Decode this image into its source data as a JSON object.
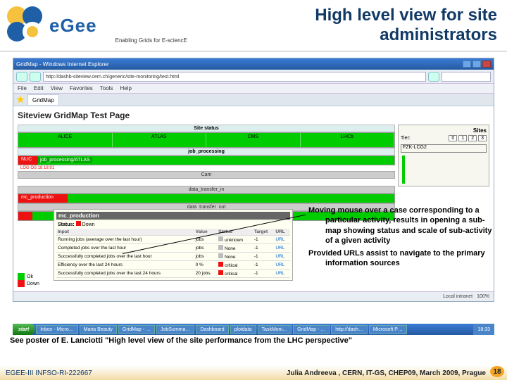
{
  "header": {
    "logo_text": "eGee",
    "tagline": "Enabling Grids for E-sciencE",
    "title_line1": "High level view for site",
    "title_line2": "administrators"
  },
  "browser": {
    "window_title": "GridMap - Windows Internet Explorer",
    "url": "http://dashb-siteview.cern.ch/generic/site-monitoring/test.html",
    "menu": [
      "File",
      "Edit",
      "View",
      "Favorites",
      "Tools",
      "Help"
    ],
    "tab": "GridMap",
    "page_title": "Siteview GridMap Test Page",
    "status": {
      "intranet": "Local intranet",
      "zoom": "100%"
    }
  },
  "gridmap": {
    "site_status_hdr": "Site status",
    "exps": [
      "ALICE",
      "ATLAS",
      "CMS",
      "LHCb"
    ],
    "job_hdr": "job_processing",
    "job_red_label": "NUC",
    "job_row_label": "job_processing/ATLAS",
    "log_line": "LOG OS 18 18:91",
    "cam_hdr": "Cam",
    "dt_in_hdr": "data_transfer_in",
    "dt_in_red": "mc_production",
    "dt_out_hdr": "data_transfer_out",
    "legend": {
      "ok": "Ok",
      "down": "Down"
    },
    "sites_hdr": "Sites",
    "tier_label": "Tier:",
    "tiers": [
      "0",
      "1",
      "2",
      "3"
    ],
    "site_select": "FZK-LCG2"
  },
  "tooltip": {
    "title": "mc_production",
    "status_label": "Status:",
    "status_value": "Down",
    "headers": [
      "Input",
      "Value",
      "Status",
      "Target",
      "URL"
    ],
    "rows": [
      {
        "name": "Running jobs (average over the last hour)",
        "value": "jobs",
        "status": "unknown",
        "target": "-1",
        "url": "URL"
      },
      {
        "name": "Completed jobs over the last hour",
        "value": "jobs",
        "status": "None",
        "target": "-1",
        "url": "URL"
      },
      {
        "name": "Successfully completed jobs over the last hour",
        "value": "jobs",
        "status": "None",
        "target": "-1",
        "url": "URL"
      },
      {
        "name": "Efficiency over the last 24 hours",
        "value": "0 %",
        "status": "critical",
        "target": "-1",
        "url": "URL"
      },
      {
        "name": "Successfully completed jobs over the last 24 hours",
        "value": "20 jobs",
        "status": "critical",
        "target": "-1",
        "url": "URL"
      }
    ]
  },
  "callout": {
    "p1": "Moving mouse over a case corresponding to a particular activity, results in opening a sub-map showing status and scale of sub-activity of a given activity",
    "p2": "Provided URLs assist to navigate to the primary information sources"
  },
  "poster_note": "See poster of E. Lanciotti \"High level view of the site performance from the LHC perspective\"",
  "taskbar": {
    "start": "start",
    "items": [
      "Inbox - Micro…",
      "Maria Beauty",
      "GridMap - …",
      "JobSumma…",
      "Dashboard",
      "plotdata",
      "TaskMoni…",
      "GridMap - …",
      "http://dash…",
      "Microsoft P…"
    ],
    "time": "18:33"
  },
  "footer": {
    "left": "EGEE-III INFSO-RI-222667",
    "right": "Julia Andreeva , CERN, IT-GS,  CHEP09, March 2009, Prague",
    "page": "18"
  }
}
